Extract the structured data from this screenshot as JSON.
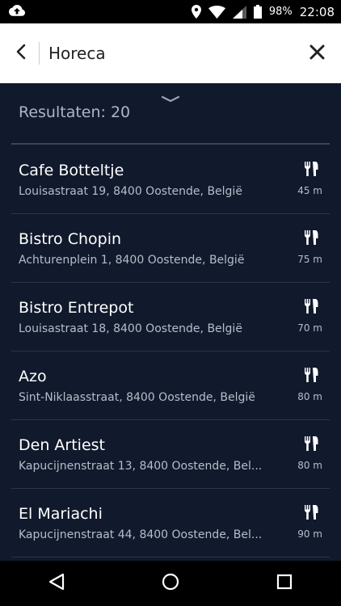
{
  "status_bar": {
    "battery": "98%",
    "time": "22:08"
  },
  "search": {
    "query": "Horeca"
  },
  "results": {
    "count_label": "Resultaten: 20",
    "items": [
      {
        "name": "Cafe Botteltje",
        "address": "Louisastraat 19, 8400 Oostende, België",
        "distance": "45 m"
      },
      {
        "name": "Bistro Chopin",
        "address": "Achturenplein 1, 8400 Oostende, België",
        "distance": "75 m"
      },
      {
        "name": "Bistro Entrepot",
        "address": "Louisastraat 18, 8400 Oostende, België",
        "distance": "70 m"
      },
      {
        "name": "Azo",
        "address": "Sint-Niklaasstraat, 8400 Oostende, België",
        "distance": "80 m"
      },
      {
        "name": "Den Artiest",
        "address": "Kapucijnenstraat 13, 8400 Oostende, Bel...",
        "distance": "80 m"
      },
      {
        "name": "El Mariachi",
        "address": "Kapucijnenstraat 44, 8400 Oostende, Bel...",
        "distance": "90 m"
      }
    ]
  },
  "icons": {
    "item": "restaurant-icon",
    "status": [
      "cloud-upload-icon",
      "location-icon",
      "wifi-icon",
      "signal-icon",
      "battery-icon"
    ],
    "nav": [
      "back-triangle-icon",
      "home-circle-icon",
      "recents-square-icon"
    ]
  },
  "colors": {
    "background": "#111a2c",
    "searchbar": "#ffffff",
    "text_primary": "#ffffff",
    "text_secondary": "#b6bdca"
  }
}
